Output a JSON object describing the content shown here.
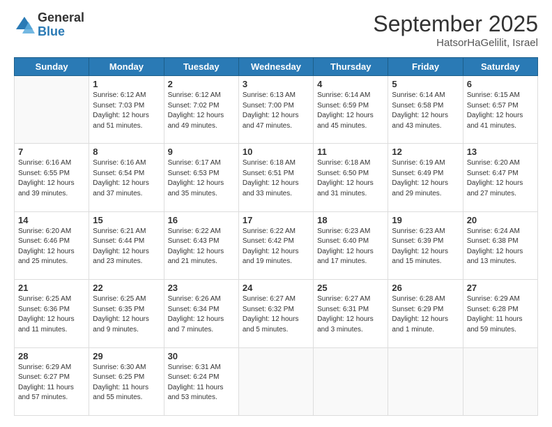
{
  "header": {
    "logo_general": "General",
    "logo_blue": "Blue",
    "month_title": "September 2025",
    "location": "HatsorHaGelilit, Israel"
  },
  "weekdays": [
    "Sunday",
    "Monday",
    "Tuesday",
    "Wednesday",
    "Thursday",
    "Friday",
    "Saturday"
  ],
  "weeks": [
    [
      {
        "day": "",
        "sunrise": "",
        "sunset": "",
        "daylight": ""
      },
      {
        "day": "1",
        "sunrise": "Sunrise: 6:12 AM",
        "sunset": "Sunset: 7:03 PM",
        "daylight": "Daylight: 12 hours and 51 minutes."
      },
      {
        "day": "2",
        "sunrise": "Sunrise: 6:12 AM",
        "sunset": "Sunset: 7:02 PM",
        "daylight": "Daylight: 12 hours and 49 minutes."
      },
      {
        "day": "3",
        "sunrise": "Sunrise: 6:13 AM",
        "sunset": "Sunset: 7:00 PM",
        "daylight": "Daylight: 12 hours and 47 minutes."
      },
      {
        "day": "4",
        "sunrise": "Sunrise: 6:14 AM",
        "sunset": "Sunset: 6:59 PM",
        "daylight": "Daylight: 12 hours and 45 minutes."
      },
      {
        "day": "5",
        "sunrise": "Sunrise: 6:14 AM",
        "sunset": "Sunset: 6:58 PM",
        "daylight": "Daylight: 12 hours and 43 minutes."
      },
      {
        "day": "6",
        "sunrise": "Sunrise: 6:15 AM",
        "sunset": "Sunset: 6:57 PM",
        "daylight": "Daylight: 12 hours and 41 minutes."
      }
    ],
    [
      {
        "day": "7",
        "sunrise": "Sunrise: 6:16 AM",
        "sunset": "Sunset: 6:55 PM",
        "daylight": "Daylight: 12 hours and 39 minutes."
      },
      {
        "day": "8",
        "sunrise": "Sunrise: 6:16 AM",
        "sunset": "Sunset: 6:54 PM",
        "daylight": "Daylight: 12 hours and 37 minutes."
      },
      {
        "day": "9",
        "sunrise": "Sunrise: 6:17 AM",
        "sunset": "Sunset: 6:53 PM",
        "daylight": "Daylight: 12 hours and 35 minutes."
      },
      {
        "day": "10",
        "sunrise": "Sunrise: 6:18 AM",
        "sunset": "Sunset: 6:51 PM",
        "daylight": "Daylight: 12 hours and 33 minutes."
      },
      {
        "day": "11",
        "sunrise": "Sunrise: 6:18 AM",
        "sunset": "Sunset: 6:50 PM",
        "daylight": "Daylight: 12 hours and 31 minutes."
      },
      {
        "day": "12",
        "sunrise": "Sunrise: 6:19 AM",
        "sunset": "Sunset: 6:49 PM",
        "daylight": "Daylight: 12 hours and 29 minutes."
      },
      {
        "day": "13",
        "sunrise": "Sunrise: 6:20 AM",
        "sunset": "Sunset: 6:47 PM",
        "daylight": "Daylight: 12 hours and 27 minutes."
      }
    ],
    [
      {
        "day": "14",
        "sunrise": "Sunrise: 6:20 AM",
        "sunset": "Sunset: 6:46 PM",
        "daylight": "Daylight: 12 hours and 25 minutes."
      },
      {
        "day": "15",
        "sunrise": "Sunrise: 6:21 AM",
        "sunset": "Sunset: 6:44 PM",
        "daylight": "Daylight: 12 hours and 23 minutes."
      },
      {
        "day": "16",
        "sunrise": "Sunrise: 6:22 AM",
        "sunset": "Sunset: 6:43 PM",
        "daylight": "Daylight: 12 hours and 21 minutes."
      },
      {
        "day": "17",
        "sunrise": "Sunrise: 6:22 AM",
        "sunset": "Sunset: 6:42 PM",
        "daylight": "Daylight: 12 hours and 19 minutes."
      },
      {
        "day": "18",
        "sunrise": "Sunrise: 6:23 AM",
        "sunset": "Sunset: 6:40 PM",
        "daylight": "Daylight: 12 hours and 17 minutes."
      },
      {
        "day": "19",
        "sunrise": "Sunrise: 6:23 AM",
        "sunset": "Sunset: 6:39 PM",
        "daylight": "Daylight: 12 hours and 15 minutes."
      },
      {
        "day": "20",
        "sunrise": "Sunrise: 6:24 AM",
        "sunset": "Sunset: 6:38 PM",
        "daylight": "Daylight: 12 hours and 13 minutes."
      }
    ],
    [
      {
        "day": "21",
        "sunrise": "Sunrise: 6:25 AM",
        "sunset": "Sunset: 6:36 PM",
        "daylight": "Daylight: 12 hours and 11 minutes."
      },
      {
        "day": "22",
        "sunrise": "Sunrise: 6:25 AM",
        "sunset": "Sunset: 6:35 PM",
        "daylight": "Daylight: 12 hours and 9 minutes."
      },
      {
        "day": "23",
        "sunrise": "Sunrise: 6:26 AM",
        "sunset": "Sunset: 6:34 PM",
        "daylight": "Daylight: 12 hours and 7 minutes."
      },
      {
        "day": "24",
        "sunrise": "Sunrise: 6:27 AM",
        "sunset": "Sunset: 6:32 PM",
        "daylight": "Daylight: 12 hours and 5 minutes."
      },
      {
        "day": "25",
        "sunrise": "Sunrise: 6:27 AM",
        "sunset": "Sunset: 6:31 PM",
        "daylight": "Daylight: 12 hours and 3 minutes."
      },
      {
        "day": "26",
        "sunrise": "Sunrise: 6:28 AM",
        "sunset": "Sunset: 6:29 PM",
        "daylight": "Daylight: 12 hours and 1 minute."
      },
      {
        "day": "27",
        "sunrise": "Sunrise: 6:29 AM",
        "sunset": "Sunset: 6:28 PM",
        "daylight": "Daylight: 11 hours and 59 minutes."
      }
    ],
    [
      {
        "day": "28",
        "sunrise": "Sunrise: 6:29 AM",
        "sunset": "Sunset: 6:27 PM",
        "daylight": "Daylight: 11 hours and 57 minutes."
      },
      {
        "day": "29",
        "sunrise": "Sunrise: 6:30 AM",
        "sunset": "Sunset: 6:25 PM",
        "daylight": "Daylight: 11 hours and 55 minutes."
      },
      {
        "day": "30",
        "sunrise": "Sunrise: 6:31 AM",
        "sunset": "Sunset: 6:24 PM",
        "daylight": "Daylight: 11 hours and 53 minutes."
      },
      {
        "day": "",
        "sunrise": "",
        "sunset": "",
        "daylight": ""
      },
      {
        "day": "",
        "sunrise": "",
        "sunset": "",
        "daylight": ""
      },
      {
        "day": "",
        "sunrise": "",
        "sunset": "",
        "daylight": ""
      },
      {
        "day": "",
        "sunrise": "",
        "sunset": "",
        "daylight": ""
      }
    ]
  ]
}
